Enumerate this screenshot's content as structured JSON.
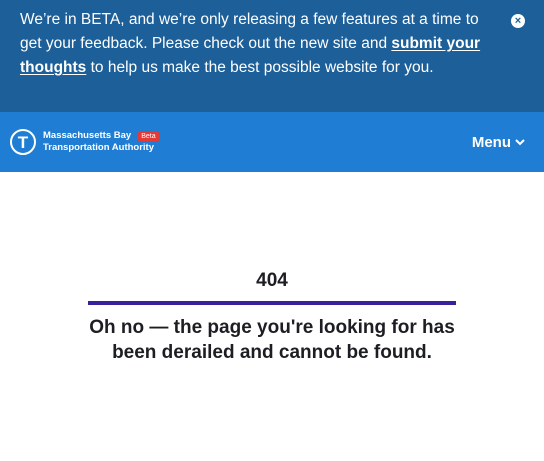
{
  "banner": {
    "text_before": "We’re in BETA, and we’re only releasing a few features at a time to get your feedback. Please check out the new site and ",
    "link_text": "submit your thoughts",
    "text_after": " to help us make the best possible website for you.",
    "close_icon": "×"
  },
  "header": {
    "logo_letter": "T",
    "org_line1": "Massachusetts Bay",
    "org_line2": "Transportation Authority",
    "beta_badge": "Beta",
    "menu_label": "Menu"
  },
  "error": {
    "code": "404",
    "message": "Oh no — the page you're looking for has been derailed and cannot be found."
  },
  "colors": {
    "banner_bg": "#1c5f99",
    "header_bg": "#1f7ed3",
    "accent_rule": "#3a1f9e",
    "beta_badge": "#e53935"
  }
}
